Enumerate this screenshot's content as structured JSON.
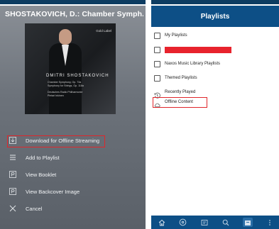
{
  "left": {
    "title": "SHOSTAKOVICH, D.: Chamber Symph...",
    "cover": {
      "label": "Gold Label",
      "composer": "DMITRI SHOSTAKOVICH",
      "lines": [
        "Chamber Symphony, Op. 73a",
        "Symphony for Strings, Op. 118a",
        "Deutsches Radio Philharmonie",
        "Pietari Inkinen"
      ]
    },
    "menu": [
      {
        "icon": "download-icon",
        "label": "Download for Offline Streaming"
      },
      {
        "icon": "list-icon",
        "label": "Add to Playlist"
      },
      {
        "icon": "booklet-icon",
        "label": "View Booklet"
      },
      {
        "icon": "image-icon",
        "label": "View Backcover Image"
      },
      {
        "icon": "close-icon",
        "label": "Cancel"
      }
    ]
  },
  "right": {
    "header": "Playlists",
    "items": [
      {
        "icon": "folder-icon",
        "label": "My Playlists"
      },
      {
        "icon": "folder-icon",
        "label": ""
      },
      {
        "icon": "folder-icon",
        "label": "Naxos Music Library Playlists"
      },
      {
        "icon": "folder-icon",
        "label": "Themed Playlists"
      },
      {
        "icon": "history-icon",
        "label": "Recently Played"
      },
      {
        "icon": "cloud-icon",
        "label": "Offline Content"
      }
    ],
    "tabs": [
      "home-icon",
      "cd-icon",
      "catalog-icon",
      "search-icon",
      "playlist-icon",
      "more-icon"
    ]
  },
  "colors": {
    "accent": "#0d4f86",
    "highlight": "#e0262b",
    "redacted": "#e8232d"
  }
}
